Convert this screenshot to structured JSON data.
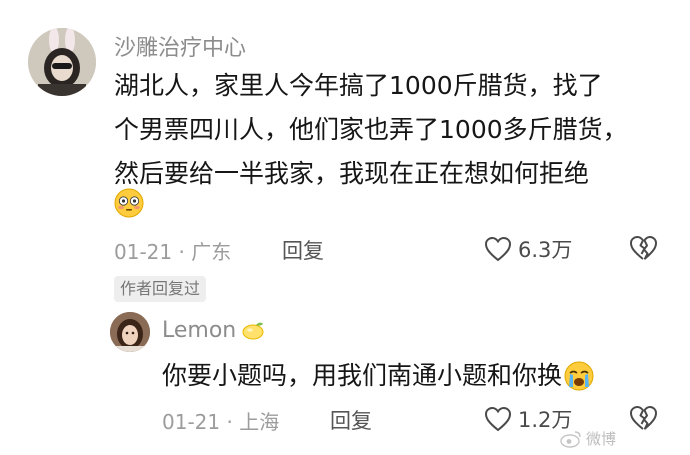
{
  "comment": {
    "username": "沙雕治疗中心",
    "lines": [
      "湖北人，家里人今年搞了1000斤腊货，找了",
      "个男票四川人，他们家也弄了1000多斤腊货，",
      "然后要给一半我家，我现在正在想如何拒绝"
    ],
    "emoji": "😳",
    "date": "01-21",
    "location": "广东",
    "reply_label": "回复",
    "like_count": "6.3万",
    "author_badge": "作者回复过"
  },
  "reply": {
    "username": "Lemon",
    "username_emoji": "🍋",
    "text": "你要小题吗，用我们南通小题和你换",
    "text_emoji": "😭",
    "date": "01-21",
    "location": "上海",
    "reply_label": "回复",
    "like_count": "1.2万"
  },
  "watermark": "微博"
}
